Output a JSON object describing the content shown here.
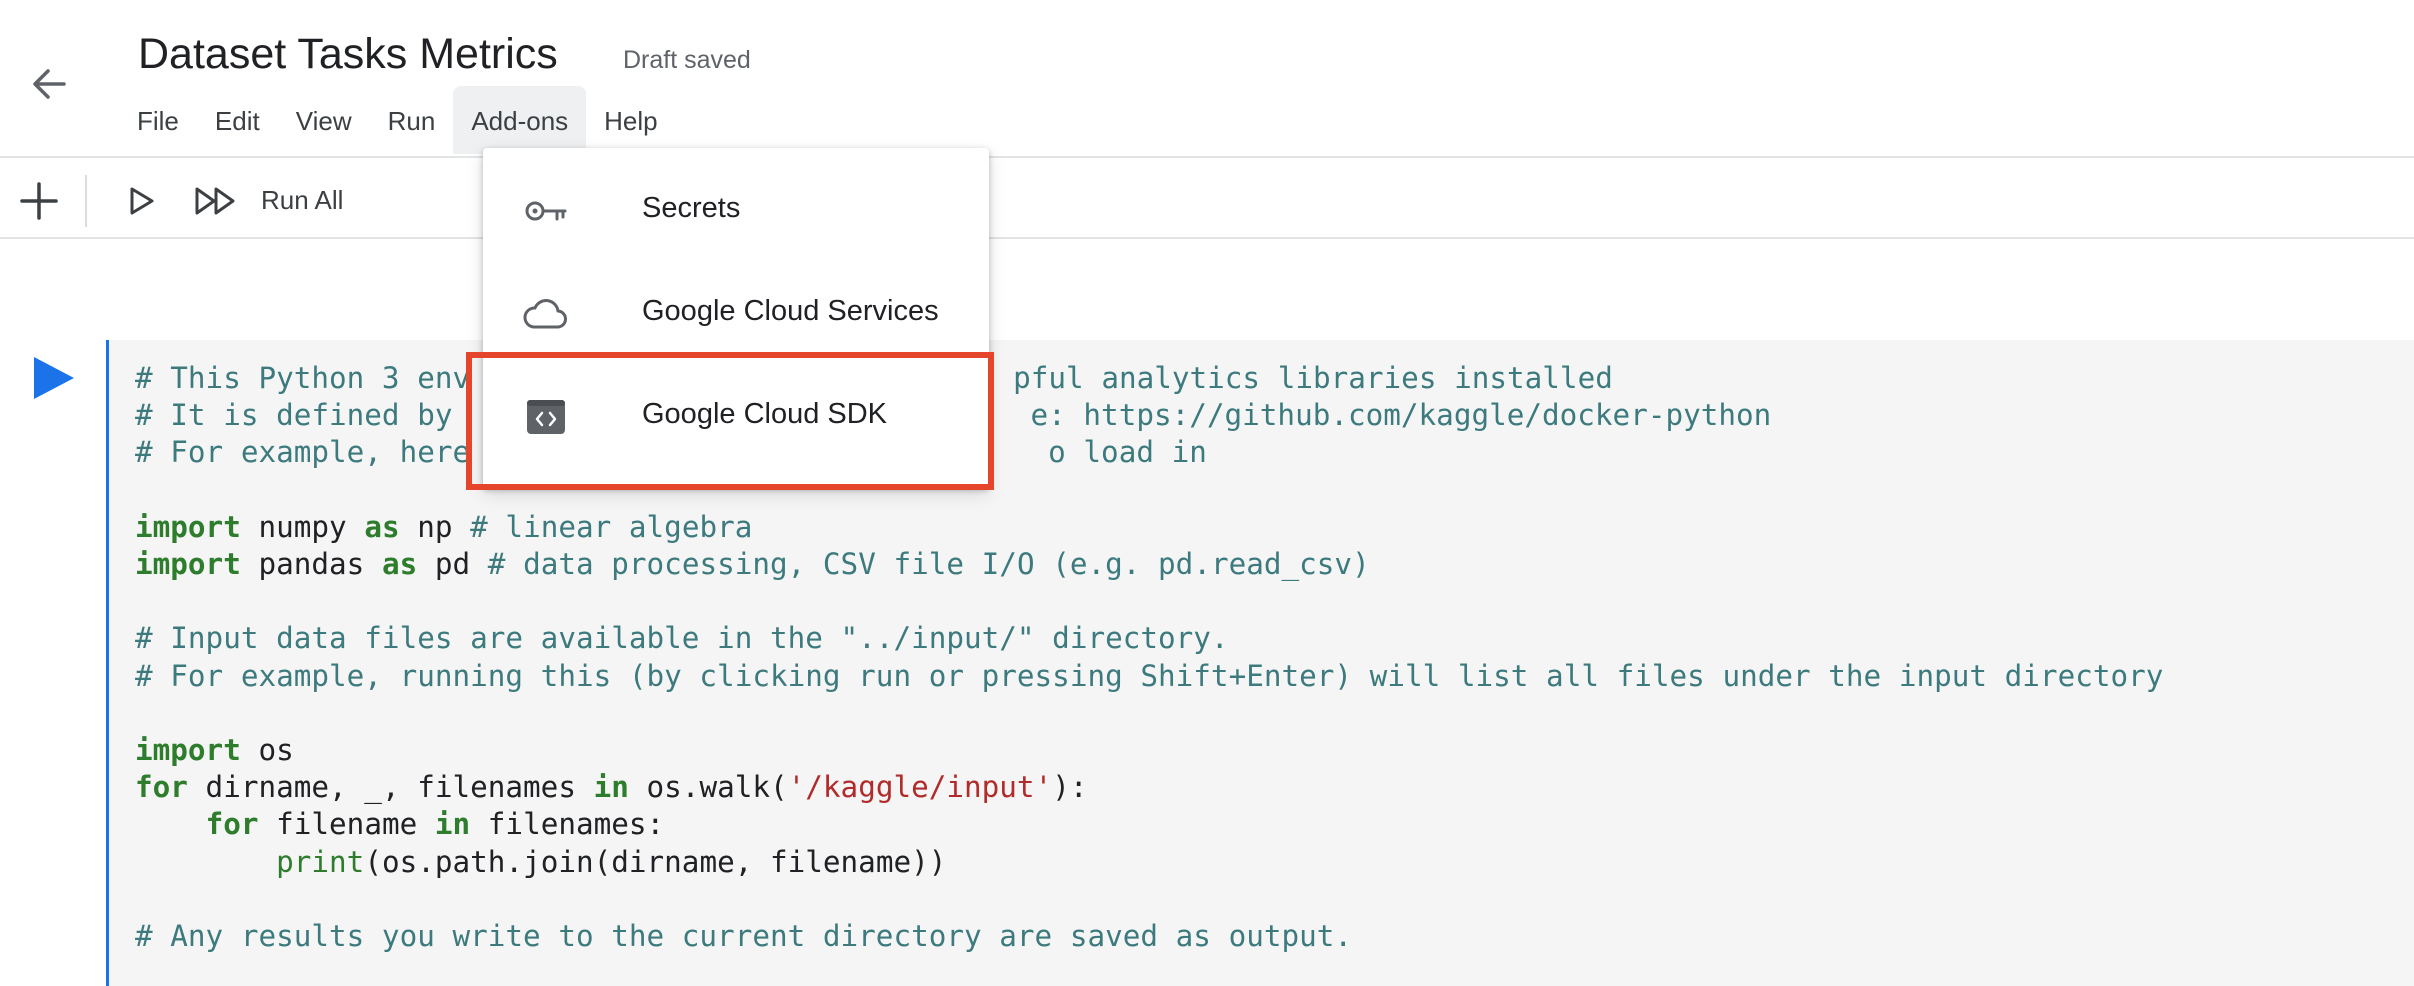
{
  "header": {
    "title": "Dataset Tasks Metrics",
    "status": "Draft saved",
    "back_icon": "arrow-left-icon"
  },
  "menubar": {
    "items": [
      "File",
      "Edit",
      "View",
      "Run",
      "Add-ons",
      "Help"
    ],
    "active": "Add-ons"
  },
  "toolbar": {
    "icons": [
      "plus-icon",
      "run-icon",
      "run-all-icon"
    ],
    "run_all_label": "Run All"
  },
  "addons_menu": {
    "items": [
      {
        "label": "Secrets",
        "icon": "key-icon"
      },
      {
        "label": "Google Cloud Services",
        "icon": "cloud-icon"
      },
      {
        "label": "Google Cloud SDK",
        "icon": "code-terminal-icon"
      }
    ],
    "highlighted": "Google Cloud SDK",
    "highlight_color": "#e5452b"
  },
  "code_cell": {
    "run_icon": "play-icon",
    "accent": "#1a73e8",
    "lines": {
      "l1_hidden_left": "# This Python 3 env",
      "l1_visible_right": "pful analytics libraries installed",
      "l2_hidden_left": "# It is defined by",
      "l2_visible_right": "e: https://github.com/kaggle/docker-python",
      "l3_hidden_left": "# For example, here",
      "l3_visible_right": "o load in",
      "l5_kw": "import",
      "l5_rest": " numpy ",
      "l5_kw2": "as",
      "l5_rest2": " np ",
      "l5_cm": "# linear algebra",
      "l6_kw": "import",
      "l6_rest": " pandas ",
      "l6_kw2": "as",
      "l6_rest2": " pd ",
      "l6_cm": "# data processing, CSV file I/O (e.g. pd.read_csv)",
      "l8_cm": "# Input data files are available in the \"../input/\" directory.",
      "l9_cm": "# For example, running this (by clicking run or pressing Shift+Enter) will list all files under the input directory",
      "l11_kw": "import",
      "l11_rest": " os",
      "l12_kw": "for",
      "l12_rest": " dirname, _, filenames ",
      "l12_kw2": "in",
      "l12_rest2": " os.walk(",
      "l12_str": "'/kaggle/input'",
      "l12_rest3": "):",
      "l13_indent": "    ",
      "l13_kw": "for",
      "l13_rest": " filename ",
      "l13_kw2": "in",
      "l13_rest2": " filenames:",
      "l14_indent": "        ",
      "l14_bi": "print",
      "l14_rest": "(os.path.join(dirname, filename))",
      "l16_cm": "# Any results you write to the current directory are saved as output."
    }
  }
}
